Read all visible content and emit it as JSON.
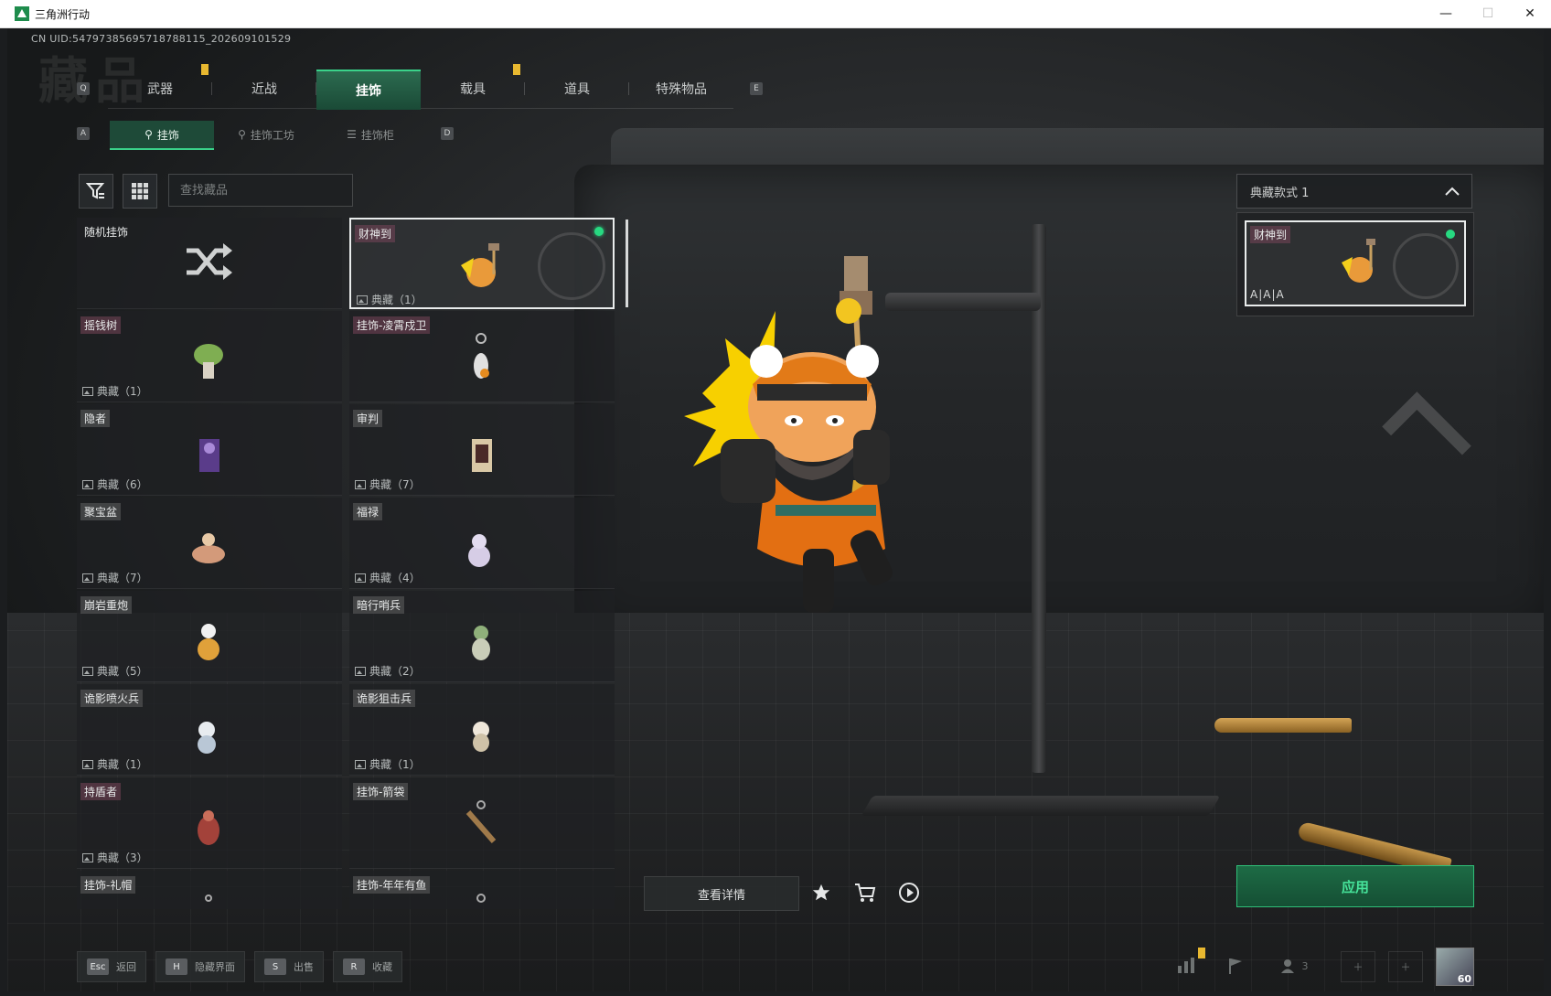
{
  "window": {
    "title": "三角洲行动",
    "controls": [
      "—",
      "☐",
      "✕"
    ]
  },
  "header": {
    "uid": "CN UID:547973856957187881​15_202609101529",
    "page_title": "藏品"
  },
  "key_hints": {
    "prev_category": "Q",
    "next_category": "E",
    "prev_sub": "A",
    "next_sub": "D"
  },
  "categories": [
    {
      "label": "武器",
      "warn": true
    },
    {
      "label": "近战",
      "warn": false
    },
    {
      "label": "挂饰",
      "warn": false,
      "active": true
    },
    {
      "label": "载具",
      "warn": true
    },
    {
      "label": "道具",
      "warn": false
    },
    {
      "label": "特殊物品",
      "warn": false
    }
  ],
  "sub_tabs": [
    {
      "label": "挂饰",
      "active": true
    },
    {
      "label": "挂饰工坊",
      "active": false
    },
    {
      "label": "挂饰柜",
      "active": false
    }
  ],
  "search": {
    "placeholder": "查找藏品"
  },
  "grid": {
    "random": {
      "label": "随机挂饰"
    },
    "items": [
      {
        "name": "财神到",
        "count": "典藏（1）",
        "selected": true,
        "equipped": true,
        "tone": "pink"
      },
      {
        "name": "摇钱树",
        "count": "典藏（1）",
        "tone": "pink"
      },
      {
        "name": "挂饰-凌霄戍卫",
        "count": "",
        "tone": "pink"
      },
      {
        "name": "隐者",
        "count": "典藏（6）",
        "tone": "gray"
      },
      {
        "name": "审判",
        "count": "典藏（7）",
        "tone": "gray"
      },
      {
        "name": "聚宝盆",
        "count": "典藏（7）",
        "tone": "gray"
      },
      {
        "name": "福禄",
        "count": "典藏（4）",
        "tone": "gray"
      },
      {
        "name": "崩岩重炮",
        "count": "典藏（5）",
        "tone": "gray"
      },
      {
        "name": "暗行哨兵",
        "count": "典藏（2）",
        "tone": "gray"
      },
      {
        "name": "诡影喷火兵",
        "count": "典藏（1）",
        "tone": "gray"
      },
      {
        "name": "诡影狙击兵",
        "count": "典藏（1）",
        "tone": "gray"
      },
      {
        "name": "持盾者",
        "count": "典藏（3）",
        "tone": "pink"
      },
      {
        "name": "挂饰-箭袋",
        "count": "",
        "tone": "gray"
      },
      {
        "name": "挂饰-礼帽",
        "count": "",
        "tone": "gray"
      },
      {
        "name": "挂饰-年年有鱼",
        "count": "",
        "tone": "gray"
      }
    ]
  },
  "actions": {
    "detail": "查看详情"
  },
  "right_panel": {
    "style_select": "典藏款式 1",
    "card": {
      "name": "财神到",
      "tag": "A|A|A"
    },
    "apply": "应用"
  },
  "footer": [
    {
      "key": "Esc",
      "label": "返回"
    },
    {
      "key": "H",
      "label": "隐藏界面"
    },
    {
      "key": "S",
      "label": "出售"
    },
    {
      "key": "R",
      "label": "收藏"
    }
  ],
  "tray": {
    "friends": "3",
    "level": "60"
  },
  "colors": {
    "accent": "#27d981",
    "active_tab": "#1e4a38",
    "warn": "#e8b830"
  }
}
